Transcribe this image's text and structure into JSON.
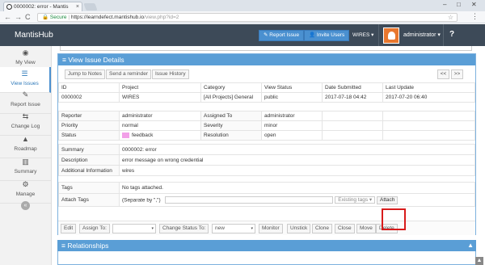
{
  "browser": {
    "tab_title": "0000002: error - Mantis",
    "tab_close": "×",
    "min": "–",
    "max": "□",
    "close": "✕",
    "back": "←",
    "forward": "→",
    "reload": "C",
    "secure_label": "Secure",
    "url_host": "https://learndefect.mantishub.io",
    "url_path": "/view.php?id=2",
    "star": "☆",
    "menu": "⋮"
  },
  "navbar": {
    "brand": "MantisHub",
    "report_issue": "Report Issue",
    "invite_users": "Invite Users",
    "project": "WIRES",
    "project_caret": "▾",
    "user": "administrator",
    "user_caret": "▾",
    "help": "?"
  },
  "sidebar": {
    "items": [
      {
        "label": "My View",
        "icon": "◉"
      },
      {
        "label": "View Issues",
        "icon": "☰"
      },
      {
        "label": "Report Issue",
        "icon": "✎"
      },
      {
        "label": "Change Log",
        "icon": "⇆"
      },
      {
        "label": "Roadmap",
        "icon": "▲"
      },
      {
        "label": "Summary",
        "icon": "▥"
      },
      {
        "label": "Manage",
        "icon": "⚙"
      }
    ],
    "collapse": "«"
  },
  "panel": {
    "title": "≡ View Issue Details",
    "buttons": {
      "jump": "Jump to Notes",
      "reminder": "Send a reminder",
      "history": "Issue History"
    },
    "prev": "<<",
    "next": ">>",
    "headers": [
      "ID",
      "Project",
      "Category",
      "View Status",
      "Date Submitted",
      "Last Update"
    ],
    "row": [
      "0000002",
      "WIRES",
      "[All Projects] General",
      "public",
      "2017-07-18 04:42",
      "2017-07-20 06:40"
    ],
    "reporter_label": "Reporter",
    "reporter": "administrator",
    "assigned_label": "Assigned To",
    "assigned": "administrator",
    "priority_label": "Priority",
    "priority": "normal",
    "severity_label": "Severity",
    "severity": "minor",
    "status_label": "Status",
    "status": "feedback",
    "resolution_label": "Resolution",
    "resolution": "open",
    "summary_label": "Summary",
    "summary": "0000002: error",
    "description_label": "Description",
    "description": "error message on wrong credential",
    "additional_label": "Additional Information",
    "additional": "wires",
    "tags_label": "Tags",
    "tags": "No tags attached.",
    "attach_label": "Attach Tags",
    "attach_hint": "(Separate by \",\")",
    "existing_tags": "Existing tags",
    "attach_btn": "Attach",
    "status_color": "#f2a0e8"
  },
  "actions": {
    "edit": "Edit",
    "assign_to": "Assign To:",
    "assign_value": "",
    "change_status": "Change Status To:",
    "status_value": "new",
    "monitor": "Monitor",
    "unstick": "Unstick",
    "clone": "Clone",
    "close": "Close",
    "move": "Move",
    "delete": "Delete",
    "caret": "▾"
  },
  "relationships": {
    "title": "≡ Relationships",
    "toggle": "▲",
    "scroll": "▲"
  }
}
